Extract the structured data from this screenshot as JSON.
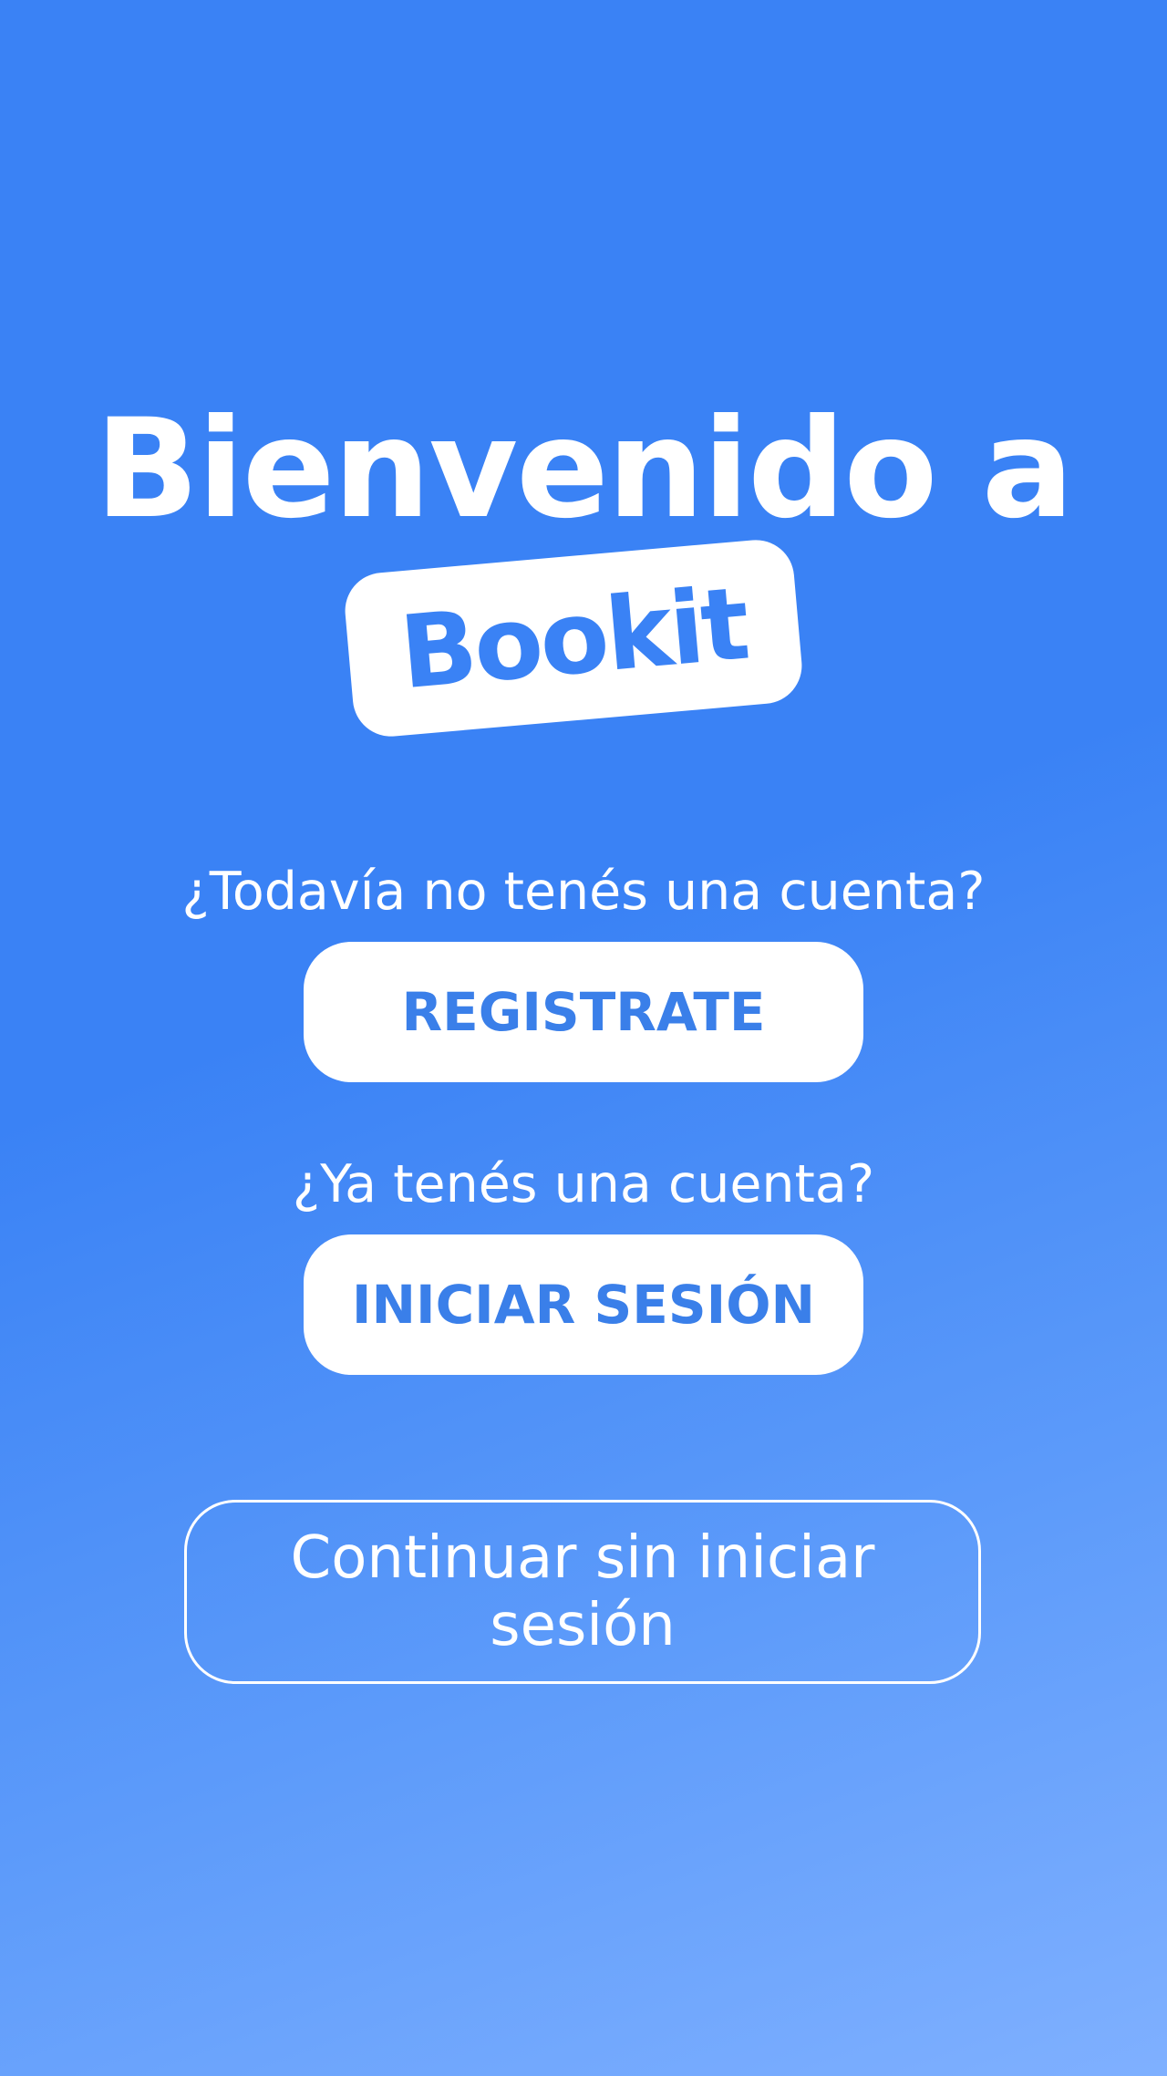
{
  "welcome": {
    "title": "Bienvenido a",
    "brand": "Bookit"
  },
  "register": {
    "question": "¿Todavía no tenés una cuenta?",
    "button_label": "REGISTRATE"
  },
  "login": {
    "question": "¿Ya tenés una cuenta?",
    "button_label": "INICIAR SESIÓN"
  },
  "guest": {
    "button_label": "Continuar sin iniciar sesión"
  },
  "colors": {
    "background_top": "#3a82f5",
    "background_bottom": "#7fb0ff",
    "accent": "#3a7fe9",
    "button_bg": "#ffffff"
  }
}
